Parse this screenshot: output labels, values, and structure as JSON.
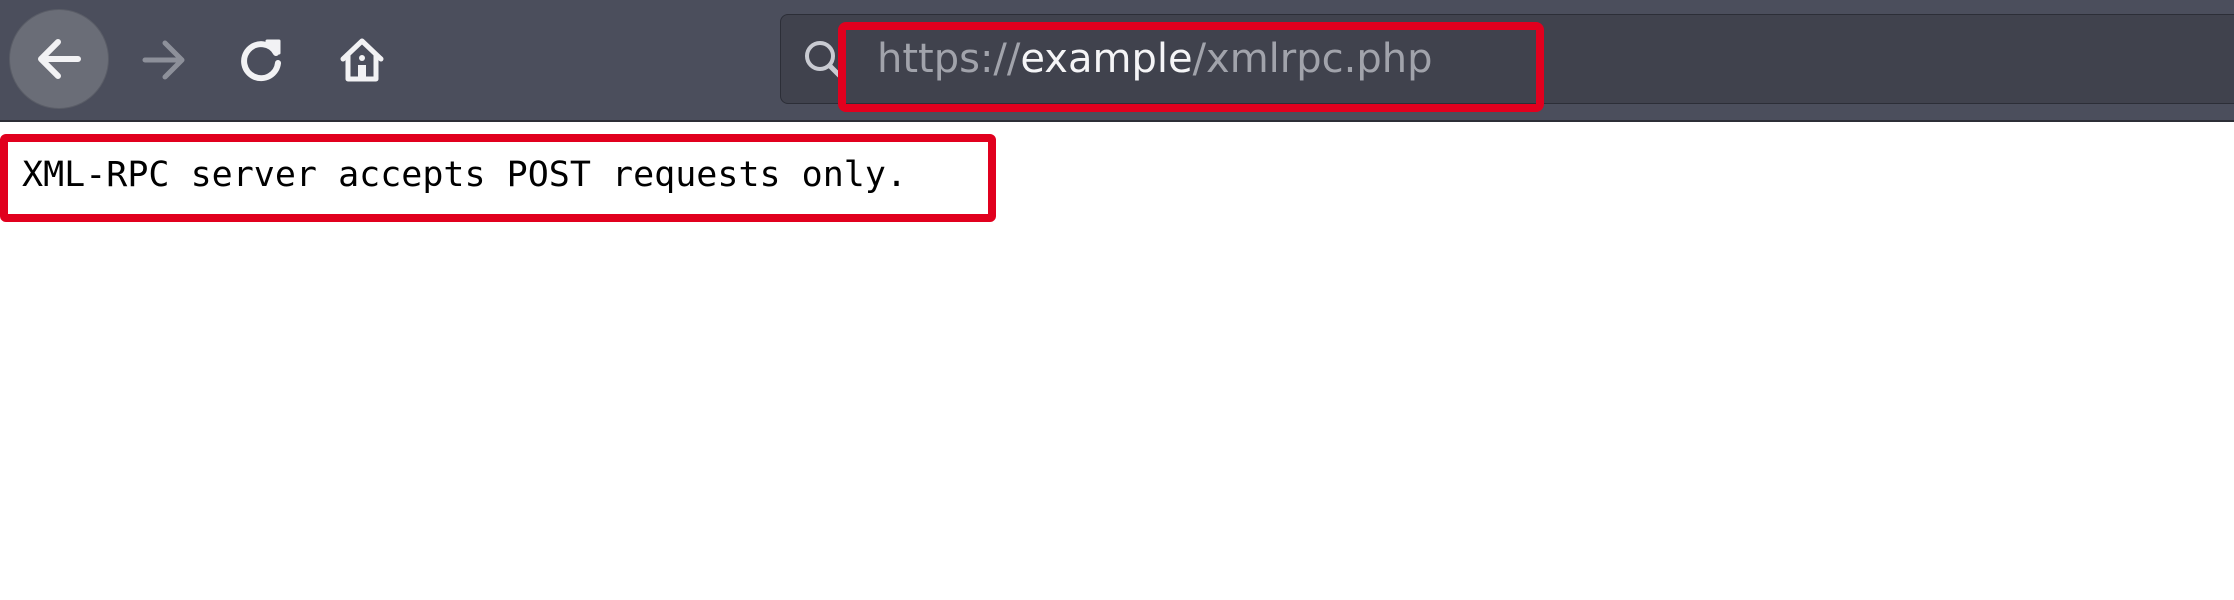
{
  "toolbar": {
    "back_icon": "back-arrow-icon",
    "forward_icon": "forward-arrow-icon",
    "reload_icon": "reload-icon",
    "home_icon": "home-icon"
  },
  "urlbar": {
    "search_icon": "search-icon",
    "scheme": "https://",
    "domain": "example",
    "path": "/xmlrpc.php"
  },
  "page": {
    "message": "XML-RPC server accepts POST requests only."
  },
  "colors": {
    "highlight": "#e1001e",
    "toolbar_bg": "#4b4e5c",
    "urlbar_bg": "#40424d"
  }
}
